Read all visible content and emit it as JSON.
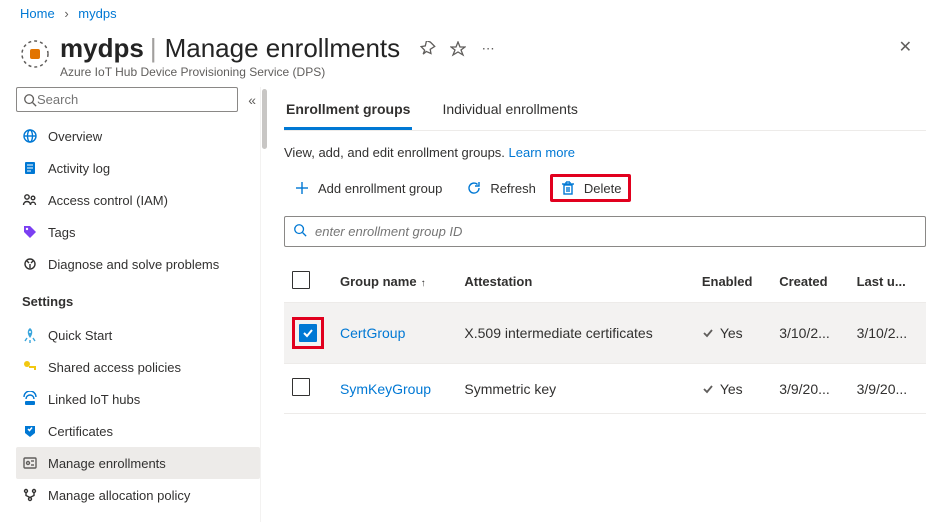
{
  "breadcrumb": {
    "home": "Home",
    "resource": "mydps"
  },
  "header": {
    "resource_name": "mydps",
    "separator": "|",
    "page_title": "Manage enrollments",
    "service": "Azure IoT Hub Device Provisioning Service (DPS)"
  },
  "sidebar": {
    "search_placeholder": "Search",
    "items": [
      {
        "id": "overview",
        "label": "Overview",
        "icon": "globe-icon",
        "color": "#0078d4"
      },
      {
        "id": "activity",
        "label": "Activity log",
        "icon": "log-icon",
        "color": "#0078d4"
      },
      {
        "id": "iam",
        "label": "Access control (IAM)",
        "icon": "iam-icon",
        "color": "#323130"
      },
      {
        "id": "tags",
        "label": "Tags",
        "icon": "tag-icon",
        "color": "#6b2fbf"
      },
      {
        "id": "diagnose",
        "label": "Diagnose and solve problems",
        "icon": "diagnose-icon",
        "color": "#323130"
      }
    ],
    "section": "Settings",
    "settings_items": [
      {
        "id": "quickstart",
        "label": "Quick Start",
        "icon": "rocket-icon",
        "color": "#2aa0da"
      },
      {
        "id": "sas",
        "label": "Shared access policies",
        "icon": "key-icon",
        "color": "#f2c811"
      },
      {
        "id": "hubs",
        "label": "Linked IoT hubs",
        "icon": "hub-icon",
        "color": "#0078d4"
      },
      {
        "id": "certs",
        "label": "Certificates",
        "icon": "cert-icon",
        "color": "#0078d4"
      },
      {
        "id": "enrollments",
        "label": "Manage enrollments",
        "icon": "enroll-icon",
        "color": "#605e5c",
        "active": true
      },
      {
        "id": "allocation",
        "label": "Manage allocation policy",
        "icon": "allocation-icon",
        "color": "#323130"
      }
    ]
  },
  "tabs": [
    {
      "id": "groups",
      "label": "Enrollment groups",
      "active": true
    },
    {
      "id": "individual",
      "label": "Individual enrollments"
    }
  ],
  "description": {
    "text": "View, add, and edit enrollment groups.",
    "link": "Learn more"
  },
  "toolbar": {
    "add": "Add enrollment group",
    "refresh": "Refresh",
    "delete": "Delete"
  },
  "filter": {
    "placeholder": "enter enrollment group ID"
  },
  "table": {
    "columns": {
      "name": "Group name",
      "attestation": "Attestation",
      "enabled": "Enabled",
      "created": "Created",
      "updated": "Last u..."
    },
    "rows": [
      {
        "selected": true,
        "name": "CertGroup",
        "attestation": "X.509 intermediate certificates",
        "enabled": "Yes",
        "created": "3/10/2...",
        "updated": "3/10/2..."
      },
      {
        "selected": false,
        "name": "SymKeyGroup",
        "attestation": "Symmetric key",
        "enabled": "Yes",
        "created": "3/9/20...",
        "updated": "3/9/20..."
      }
    ]
  }
}
